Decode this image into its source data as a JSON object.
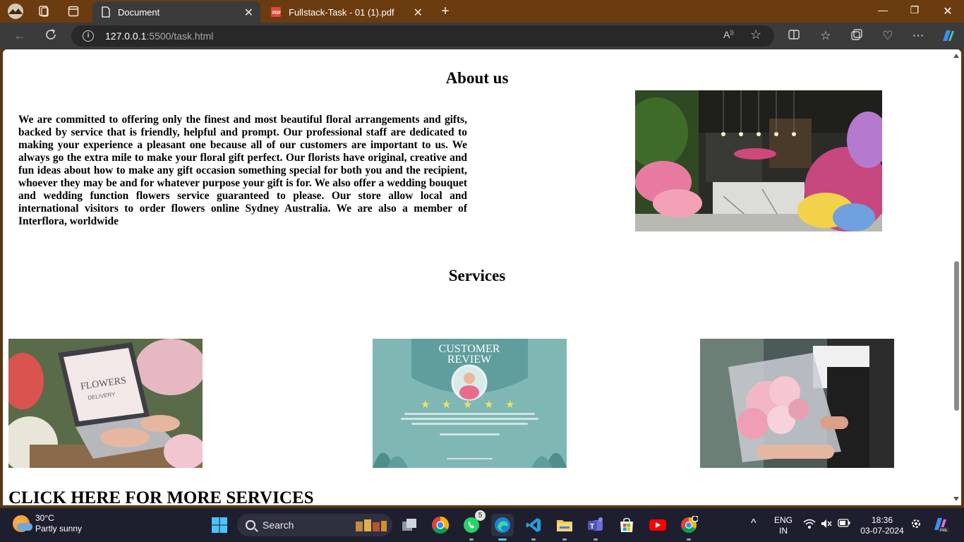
{
  "browser": {
    "tabs": [
      {
        "title": "Document",
        "active": true
      },
      {
        "title": "Fullstack-Task - 01 (1).pdf",
        "active": false
      }
    ],
    "url_host": "127.0.0.1",
    "url_path": ":5500/task.html"
  },
  "page": {
    "about_heading": "About us",
    "about_text": "We are committed to offering only the finest and most beautiful floral arrangements and gifts, backed by service that is friendly, helpful and prompt. Our professional staff are dedicated to making your experience a pleasant one because all of our customers are important to us. We always go the extra mile to make your floral gift perfect. Our florists have original, creative and fun ideas about how to make any gift occasion something special for both you and the recipient, whoever they may be and for whatever purpose your gift is for. We also offer a wedding bouquet and wedding function flowers service guaranteed to please. Our store allow local and international visitors to order flowers online Sydney Australia. We are also a member of Interflora, worldwide",
    "services_heading": "Services",
    "service_images": [
      {
        "laptop_text_1": "FLOWERS",
        "laptop_text_2": "DELIVERY"
      },
      {
        "title_1": "CUSTOMER",
        "title_2": "REVIEW"
      },
      {}
    ],
    "more_link": "CLICK HERE FOR MORE SERVICES"
  },
  "taskbar": {
    "temperature": "30°C",
    "weather": "Partly sunny",
    "search_label": "Search",
    "whatsapp_badge": "5",
    "lang_1": "ENG",
    "lang_2": "IN",
    "time": "18:36",
    "date": "03-07-2024"
  },
  "colors": {
    "tab_strip": "#6b3c10",
    "toolbar": "#3b3b3b",
    "taskbar": "#1e1f2e",
    "page_bg": "#ffffff",
    "review_teal": "#7fb7b5"
  }
}
